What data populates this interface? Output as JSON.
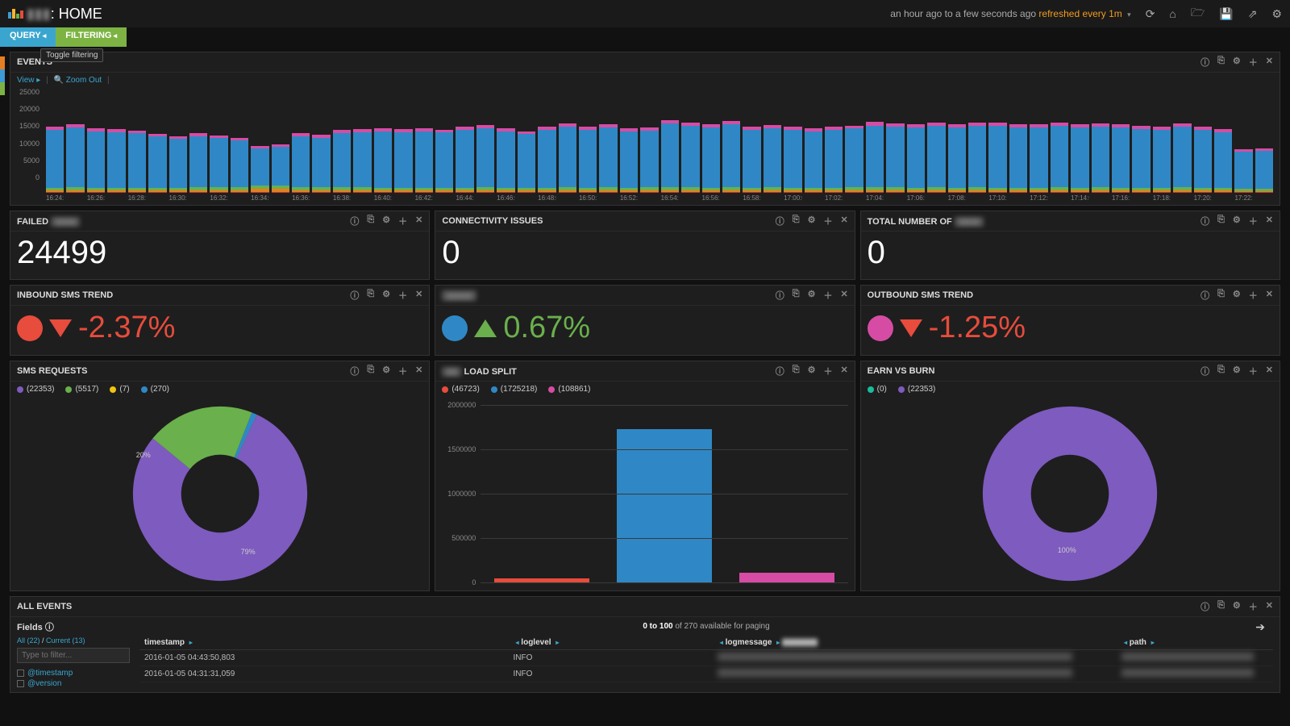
{
  "header": {
    "app_prefix": "▮▮▮",
    "title": ": HOME",
    "time_range": "an hour ago to a few seconds ago ",
    "refresh_text": "refreshed every 1m"
  },
  "tabs": {
    "query": "QUERY",
    "filtering": "FILTERING",
    "toggle_tip": "Toggle filtering"
  },
  "events_panel": {
    "title": "EVENTS",
    "view": "View",
    "zoom": "Zoom Out",
    "y_ticks": [
      "25000",
      "20000",
      "15000",
      "10000",
      "5000",
      "0"
    ]
  },
  "stat_row": {
    "failed": {
      "title": "FAILED",
      "value": "24499"
    },
    "conn": {
      "title": "CONNECTIVITY ISSUES",
      "value": "0"
    },
    "total": {
      "title": "TOTAL NUMBER OF",
      "value": "0"
    }
  },
  "trend_row": {
    "inbound": {
      "title": "INBOUND SMS TREND",
      "value": "-2.37%",
      "dir": "down",
      "color": "red",
      "dot": "red-dot"
    },
    "mid": {
      "title": "▮▮▮▮▮",
      "value": "0.67%",
      "dir": "up",
      "color": "green",
      "dot": "blue-dot"
    },
    "outbound": {
      "title": "OUTBOUND SMS TREND",
      "value": "-1.25%",
      "dir": "down",
      "color": "red",
      "dot": "pink-dot"
    }
  },
  "sms_requests": {
    "title": "SMS REQUESTS",
    "legend": [
      {
        "color": "c-purple",
        "label": "(22353)"
      },
      {
        "color": "c-green",
        "label": "(5517)"
      },
      {
        "color": "c-yellow",
        "label": "(7)"
      },
      {
        "color": "c-blue",
        "label": "(270)"
      }
    ],
    "slice_labels": {
      "green": "20%",
      "purple": "79%"
    }
  },
  "load_split": {
    "title": "LOAD SPLIT",
    "legend": [
      {
        "color": "c-red",
        "label": "(46723)"
      },
      {
        "color": "c-blue",
        "label": "(1725218)"
      },
      {
        "color": "c-pink",
        "label": "(108861)"
      }
    ],
    "y_ticks": [
      "2000000",
      "1500000",
      "1000000",
      "500000",
      "0"
    ]
  },
  "earn_burn": {
    "title": "EARN VS BURN",
    "legend": [
      {
        "color": "c-cyan",
        "label": "(0)"
      },
      {
        "color": "c-purple",
        "label": "(22353)"
      }
    ],
    "slice_label": "100%"
  },
  "all_events": {
    "title": "ALL EVENTS",
    "fields_title": "Fields",
    "links": {
      "all": "All (22)",
      "sep": " / ",
      "current": "Current (13)"
    },
    "filter_placeholder": "Type to filter...",
    "field_items": [
      "@timestamp",
      "@version"
    ],
    "paging_prefix": "0 to 100",
    "paging_suffix": " of 270 available for paging",
    "columns": [
      "timestamp",
      "loglevel",
      "logmessage",
      "path"
    ],
    "rows": [
      {
        "ts": "2016-01-05 04:43:50,803",
        "lvl": "INFO"
      },
      {
        "ts": "2016-01-05 04:31:31,059",
        "lvl": "INFO"
      }
    ]
  },
  "chart_data": [
    {
      "type": "bar",
      "title": "EVENTS",
      "stacked": true,
      "ylim": [
        0,
        25000
      ],
      "categories": [
        "16:24:00",
        "16:26:00",
        "16:28:00",
        "16:30:00",
        "16:32:00",
        "16:34:00",
        "16:36:00",
        "16:38:00",
        "16:40:00",
        "16:42:00",
        "16:44:00",
        "16:46:00",
        "16:48:00",
        "16:50:00",
        "16:52:00",
        "16:54:00",
        "16:56:00",
        "16:58:00",
        "17:00:00",
        "17:02:00",
        "17:04:00",
        "17:06:00",
        "17:08:00",
        "17:10:00",
        "17:12:00",
        "17:14:00",
        "17:16:00",
        "17:18:00",
        "17:20:00",
        "17:22:00"
      ],
      "series": [
        {
          "name": "pink",
          "values": [
            800,
            800,
            750,
            700,
            750,
            650,
            800,
            800,
            850,
            800,
            850,
            800,
            850,
            800,
            850,
            900,
            900,
            850,
            850,
            800,
            900,
            850,
            850,
            900,
            850,
            850,
            850,
            800,
            800,
            600
          ]
        },
        {
          "name": "blue",
          "values": [
            15500,
            15000,
            14500,
            13000,
            13000,
            10000,
            13500,
            14500,
            15000,
            15000,
            15500,
            15000,
            15500,
            15500,
            15000,
            17000,
            16000,
            15500,
            15500,
            15500,
            16500,
            16000,
            16000,
            16500,
            16000,
            16000,
            16000,
            15500,
            15500,
            10000
          ]
        },
        {
          "name": "green",
          "values": [
            800,
            800,
            800,
            800,
            900,
            900,
            900,
            900,
            800,
            800,
            800,
            800,
            800,
            800,
            800,
            900,
            800,
            800,
            800,
            800,
            900,
            800,
            800,
            800,
            800,
            800,
            800,
            800,
            800,
            600
          ]
        },
        {
          "name": "orange",
          "values": [
            400,
            400,
            400,
            400,
            500,
            700,
            500,
            400,
            400,
            400,
            400,
            400,
            400,
            400,
            400,
            500,
            400,
            400,
            400,
            400,
            400,
            400,
            400,
            400,
            400,
            400,
            400,
            400,
            400,
            300
          ]
        },
        {
          "name": "red",
          "values": [
            200,
            200,
            200,
            200,
            200,
            300,
            200,
            200,
            200,
            200,
            200,
            200,
            200,
            200,
            200,
            200,
            200,
            200,
            200,
            200,
            200,
            200,
            200,
            200,
            200,
            200,
            200,
            200,
            200,
            150
          ]
        }
      ]
    },
    {
      "type": "pie",
      "title": "SMS REQUESTS",
      "series": [
        {
          "name": "purple",
          "value": 22353,
          "pct": 79
        },
        {
          "name": "green",
          "value": 5517,
          "pct": 20
        },
        {
          "name": "yellow",
          "value": 7,
          "pct": 0.02
        },
        {
          "name": "blue",
          "value": 270,
          "pct": 0.96
        }
      ]
    },
    {
      "type": "bar",
      "title": "LOAD SPLIT",
      "ylim": [
        0,
        2000000
      ],
      "categories": [
        "red",
        "blue",
        "pink"
      ],
      "values": [
        46723,
        1725218,
        108861
      ]
    },
    {
      "type": "pie",
      "title": "EARN VS BURN",
      "series": [
        {
          "name": "cyan",
          "value": 0,
          "pct": 0
        },
        {
          "name": "purple",
          "value": 22353,
          "pct": 100
        }
      ]
    }
  ]
}
